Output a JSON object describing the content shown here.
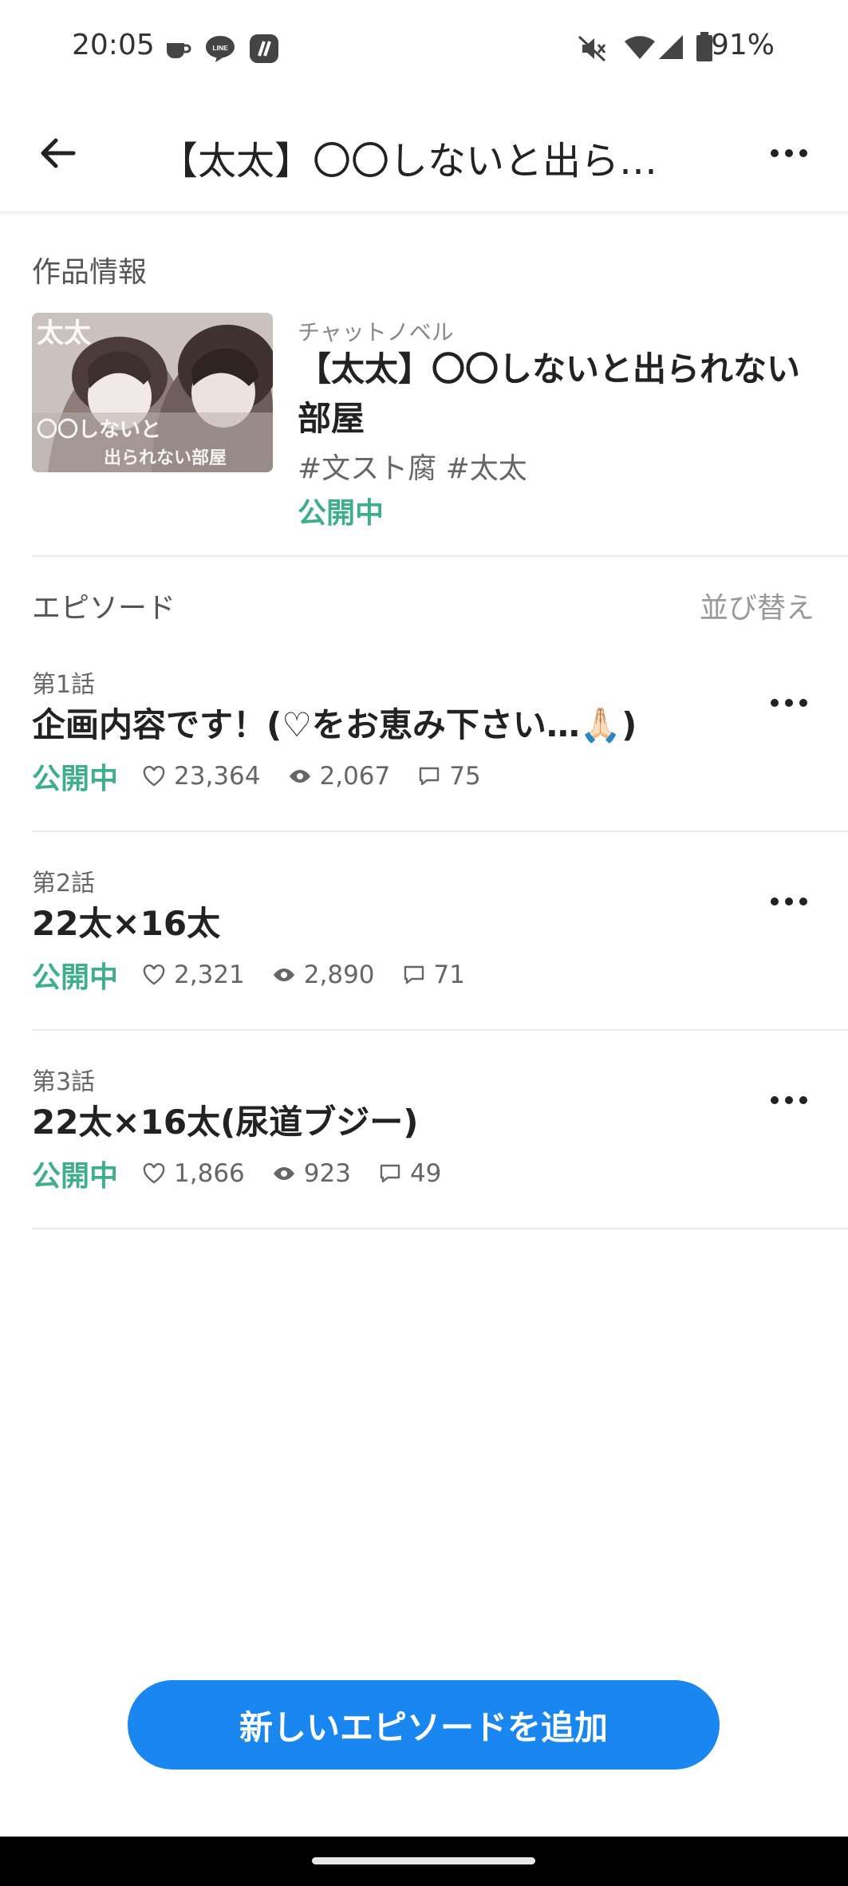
{
  "status_bar": {
    "time": "20:05",
    "battery": "91%",
    "line_badge": "LINE"
  },
  "app_bar": {
    "title": "【太太】〇〇しないと出ら…"
  },
  "work_info": {
    "section_label": "作品情報",
    "type": "チャットノベル",
    "title": "【太太】〇〇しないと出られない部屋",
    "tags": "#文スト腐 #太太",
    "status": "公開中",
    "thumbnail_text": {
      "line1": "太太",
      "line2": "〇〇しないと",
      "line3": "出られない部屋"
    }
  },
  "episodes_section": {
    "label": "エピソード",
    "sort_label": "並び替え"
  },
  "episodes": [
    {
      "number": "第1話",
      "title": "企画内容です！(♡をお恵み下さい…🙏🏻)",
      "status": "公開中",
      "likes": "23,364",
      "views": "2,067",
      "comments": "75"
    },
    {
      "number": "第2話",
      "title": "22太×16太",
      "status": "公開中",
      "likes": "2,321",
      "views": "2,890",
      "comments": "71"
    },
    {
      "number": "第3話",
      "title": "22太×16太(尿道ブジー)",
      "status": "公開中",
      "likes": "1,866",
      "views": "923",
      "comments": "49"
    }
  ],
  "add_button": {
    "label": "新しいエピソードを追加"
  },
  "icons": [
    "coffee-icon",
    "line-icon",
    "pixiv-icon",
    "mute-icon",
    "wifi-icon",
    "signal-icon",
    "battery-icon",
    "back-arrow-icon",
    "more-icon",
    "heart-icon",
    "eye-icon",
    "comment-icon"
  ],
  "colors": {
    "accent_blue": "#1a86f0",
    "status_green": "#3fae8a"
  }
}
